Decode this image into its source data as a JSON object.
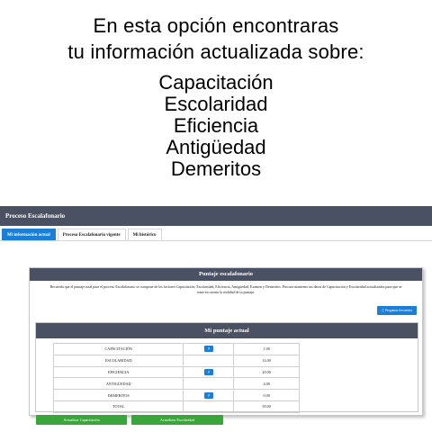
{
  "intro": {
    "line1": "En esta opción encontraras",
    "line2": "tu información actualizada sobre:",
    "topics": [
      "Capacitación",
      "Escolaridad",
      "Eficiencia",
      "Antigüedad",
      "Demeritos"
    ]
  },
  "app": {
    "header_title": "Proceso Escalafonario",
    "tabs": [
      {
        "label": "Mi información actual"
      },
      {
        "label": "Proceso Escalafonario vigente"
      },
      {
        "label": "Mi histórico"
      }
    ],
    "card": {
      "title": "Puntaje escalafonario",
      "description": "Recuerda que el puntaje total para el proceso Escalafonario se compone de los factores Capacitación, Escolaridad, Eficiencia, Antigüedad, Examen y Demeritos. Procura mantener tus datos de Capacitación y Escolaridad actualizados para que se tome en cuenta la realidad de tu puntaje.",
      "help_button": "Preguntas frecuentes",
      "score_title": "Mi puntaje actual",
      "rows": [
        {
          "factor": "CAPACITACIÓN",
          "help": "?",
          "value": "1.00"
        },
        {
          "factor": "ESCOLARIDAD",
          "help": "",
          "value": "14.00"
        },
        {
          "factor": "EFICIENCIA",
          "help": "?",
          "value": "20.00"
        },
        {
          "factor": "ANTIGÜEDAD",
          "help": "",
          "value": "4.00"
        },
        {
          "factor": "DEMERITOS",
          "help": "?",
          "value": "0.00"
        },
        {
          "factor": "TOTAL",
          "help": "",
          "value": "39.00"
        }
      ]
    },
    "buttons": {
      "update_training": "Actualizar Capacitación",
      "update_schooling": "Actualizar Escolaridad"
    }
  },
  "colors": {
    "header": "#4a5163",
    "accent_blue": "#1c7fd6",
    "green": "#3aa53a"
  },
  "icons": {
    "help": "info-circle-icon"
  }
}
